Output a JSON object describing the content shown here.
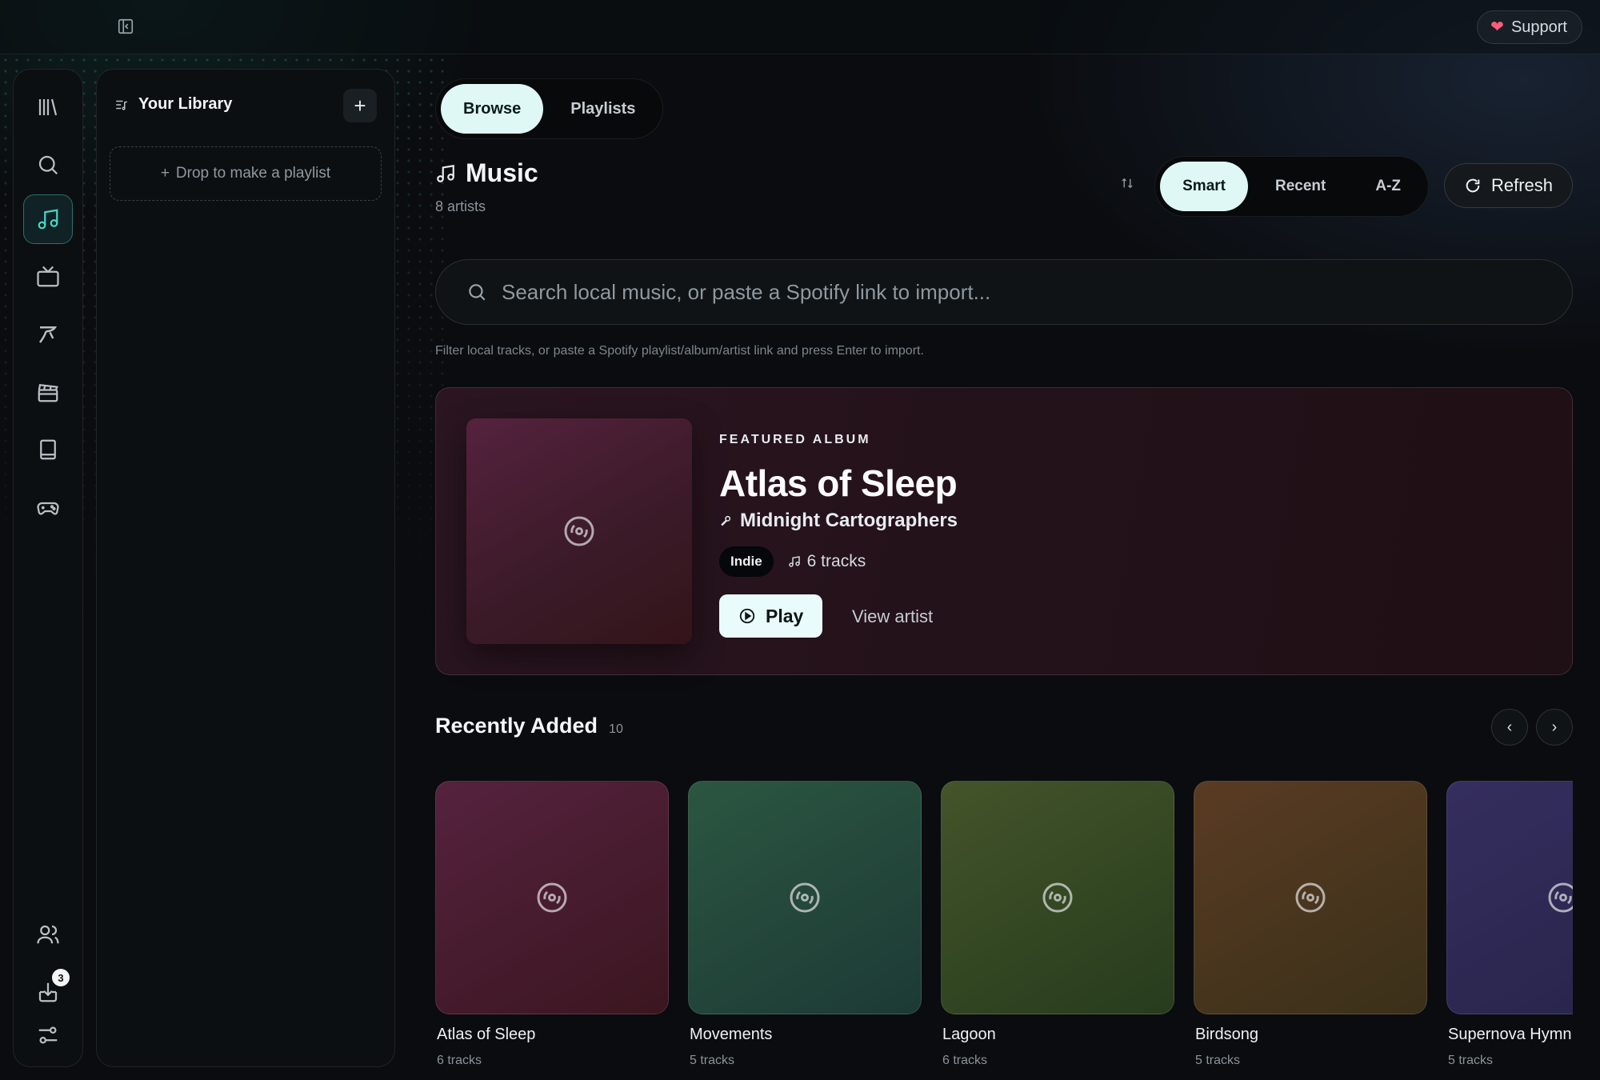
{
  "topbar": {
    "support_label": "Support"
  },
  "library": {
    "title": "Your Library",
    "add_label": "+",
    "drop_label": "Drop to make a playlist"
  },
  "nav": {
    "items": [
      "library-icon",
      "search-icon",
      "music-icon",
      "tv-icon",
      "brush-icon",
      "clapperboard-icon",
      "book-icon",
      "gamepad-icon",
      "users-icon",
      "download-icon",
      "settings-sliders-icon"
    ],
    "active": "music-icon",
    "download_badge": "3"
  },
  "view_tabs": {
    "browse": "Browse",
    "playlists": "Playlists",
    "active": "Browse"
  },
  "page": {
    "title": "Music",
    "subtitle": "8 artists"
  },
  "sort": {
    "smart": "Smart",
    "recent": "Recent",
    "az": "A-Z",
    "active": "Smart"
  },
  "refresh_label": "Refresh",
  "search": {
    "placeholder": "Search local music, or paste a Spotify link to import...",
    "value": "",
    "hint": "Filter local tracks, or paste a Spotify playlist/album/artist link and press Enter to import."
  },
  "featured": {
    "kicker": "FEATURED ALBUM",
    "title": "Atlas of Sleep",
    "artist": "Midnight Cartographers",
    "genre": "Indie",
    "tracks": "6 tracks",
    "play_label": "Play",
    "view_artist_label": "View artist"
  },
  "recently_added": {
    "title": "Recently Added",
    "count": "10",
    "items": [
      {
        "name": "Atlas of Sleep",
        "tracks": "6 tracks",
        "colors": [
          "#55223e",
          "#3b1620"
        ]
      },
      {
        "name": "Movements",
        "tracks": "5 tracks",
        "colors": [
          "#2c5641",
          "#1c3a35"
        ]
      },
      {
        "name": "Lagoon",
        "tracks": "6 tracks",
        "colors": [
          "#44542a",
          "#263c1d"
        ]
      },
      {
        "name": "Birdsong",
        "tracks": "5 tracks",
        "colors": [
          "#5a3b23",
          "#3a3019"
        ]
      },
      {
        "name": "Supernova Hymn",
        "tracks": "5 tracks",
        "colors": [
          "#352e5e",
          "#26244a"
        ]
      }
    ]
  },
  "colors": {
    "accent": "#4ad3c3",
    "heart": "#ff5c79",
    "pill_active": "#dff8f6"
  }
}
